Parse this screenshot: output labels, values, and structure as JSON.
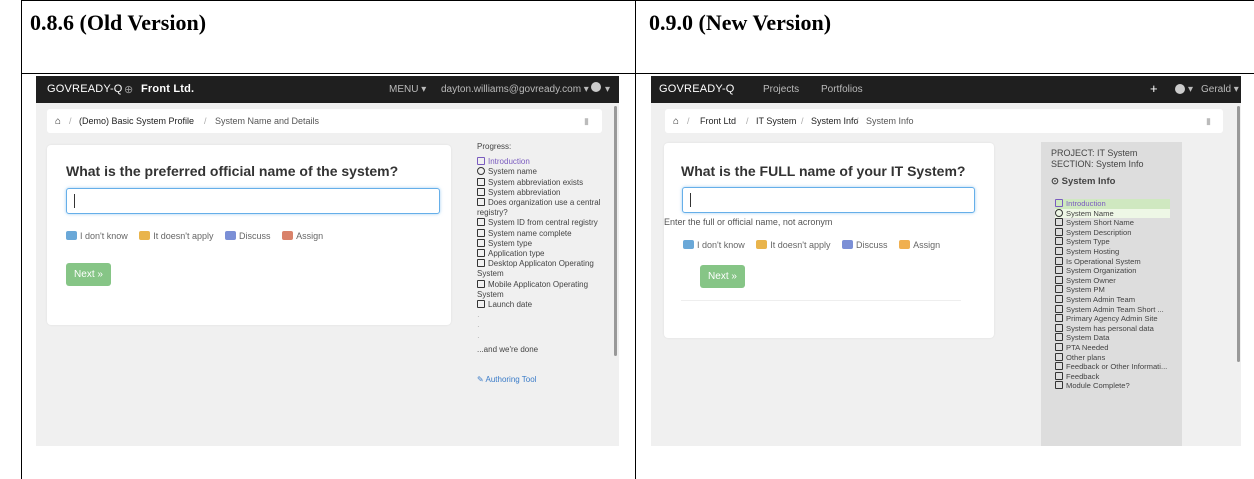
{
  "columns": {
    "old_label": "0.8.6 (Old Version)",
    "new_label": "0.9.0 (New Version)"
  },
  "old": {
    "brand": "GOVREADY-Q",
    "org": "Front Ltd.",
    "menu": "MENU ▾",
    "user": "dayton.williams@govready.com ▾",
    "breadcrumb": [
      "(Demo) Basic System Profile",
      "System Name and Details"
    ],
    "question": "What is the preferred official name of the system?",
    "input_value": "",
    "actions": [
      "I don't know",
      "It doesn't apply",
      "Discuss",
      "Assign"
    ],
    "next": "Next »",
    "progress_title": "Progress:",
    "progress": [
      {
        "label": "Introduction",
        "state": "done"
      },
      {
        "label": "System name",
        "state": "current"
      },
      {
        "label": "System abbreviation exists",
        "state": "todo"
      },
      {
        "label": "System abbreviation",
        "state": "todo"
      },
      {
        "label": "Does organization use a central",
        "state": "todo"
      },
      {
        "label": "registry?",
        "state": "cont"
      },
      {
        "label": "System ID from central registry",
        "state": "todo"
      },
      {
        "label": "System name complete",
        "state": "todo"
      },
      {
        "label": "System type",
        "state": "todo"
      },
      {
        "label": "Application type",
        "state": "todo"
      },
      {
        "label": "Desktop Applicaton Operating",
        "state": "todo"
      },
      {
        "label": "System",
        "state": "cont"
      },
      {
        "label": "Mobile Applicaton Operating",
        "state": "todo"
      },
      {
        "label": "System",
        "state": "cont"
      },
      {
        "label": "Launch date",
        "state": "todo"
      }
    ],
    "progress_end": "...and we're done",
    "authoring": "Authoring Tool"
  },
  "new": {
    "brand": "GOVREADY-Q",
    "nav": [
      "Projects",
      "Portfolios"
    ],
    "user": "Gerald ▾",
    "breadcrumb": [
      "Front Ltd",
      "IT System",
      "System Info",
      "System Info"
    ],
    "question": "What is the FULL name of your IT System?",
    "input_value": "",
    "help": "Enter the full or official name, not acronym",
    "actions": [
      "I don't know",
      "It doesn't apply",
      "Discuss",
      "Assign"
    ],
    "next": "Next »",
    "project": "PROJECT: IT System",
    "section": "SECTION: System Info",
    "section_title": "System Info",
    "progress": [
      {
        "label": "Introduction",
        "state": "done"
      },
      {
        "label": "System Name",
        "state": "current"
      },
      {
        "label": "System Short Name",
        "state": "todo"
      },
      {
        "label": "System Description",
        "state": "todo"
      },
      {
        "label": "System Type",
        "state": "todo"
      },
      {
        "label": "System Hosting",
        "state": "todo"
      },
      {
        "label": "Is Operational System",
        "state": "todo"
      },
      {
        "label": "System Organization",
        "state": "todo"
      },
      {
        "label": "System Owner",
        "state": "todo"
      },
      {
        "label": "System PM",
        "state": "todo"
      },
      {
        "label": "System Admin Team",
        "state": "todo"
      },
      {
        "label": "System Admin Team Short ...",
        "state": "todo"
      },
      {
        "label": "Primary Agency Admin Site",
        "state": "todo"
      },
      {
        "label": "System has personal data",
        "state": "todo"
      },
      {
        "label": "System Data",
        "state": "todo"
      },
      {
        "label": "PTA Needed",
        "state": "todo"
      },
      {
        "label": "Other plans",
        "state": "todo"
      },
      {
        "label": "Feedback or Other Informati...",
        "state": "todo"
      },
      {
        "label": "Feedback",
        "state": "todo"
      },
      {
        "label": "Module Complete?",
        "state": "todo"
      }
    ]
  },
  "colors": {
    "navbar": "#1f1f1f",
    "next": "#86c586",
    "input_focus": "#66afe9",
    "done": "#7a5bbf"
  }
}
